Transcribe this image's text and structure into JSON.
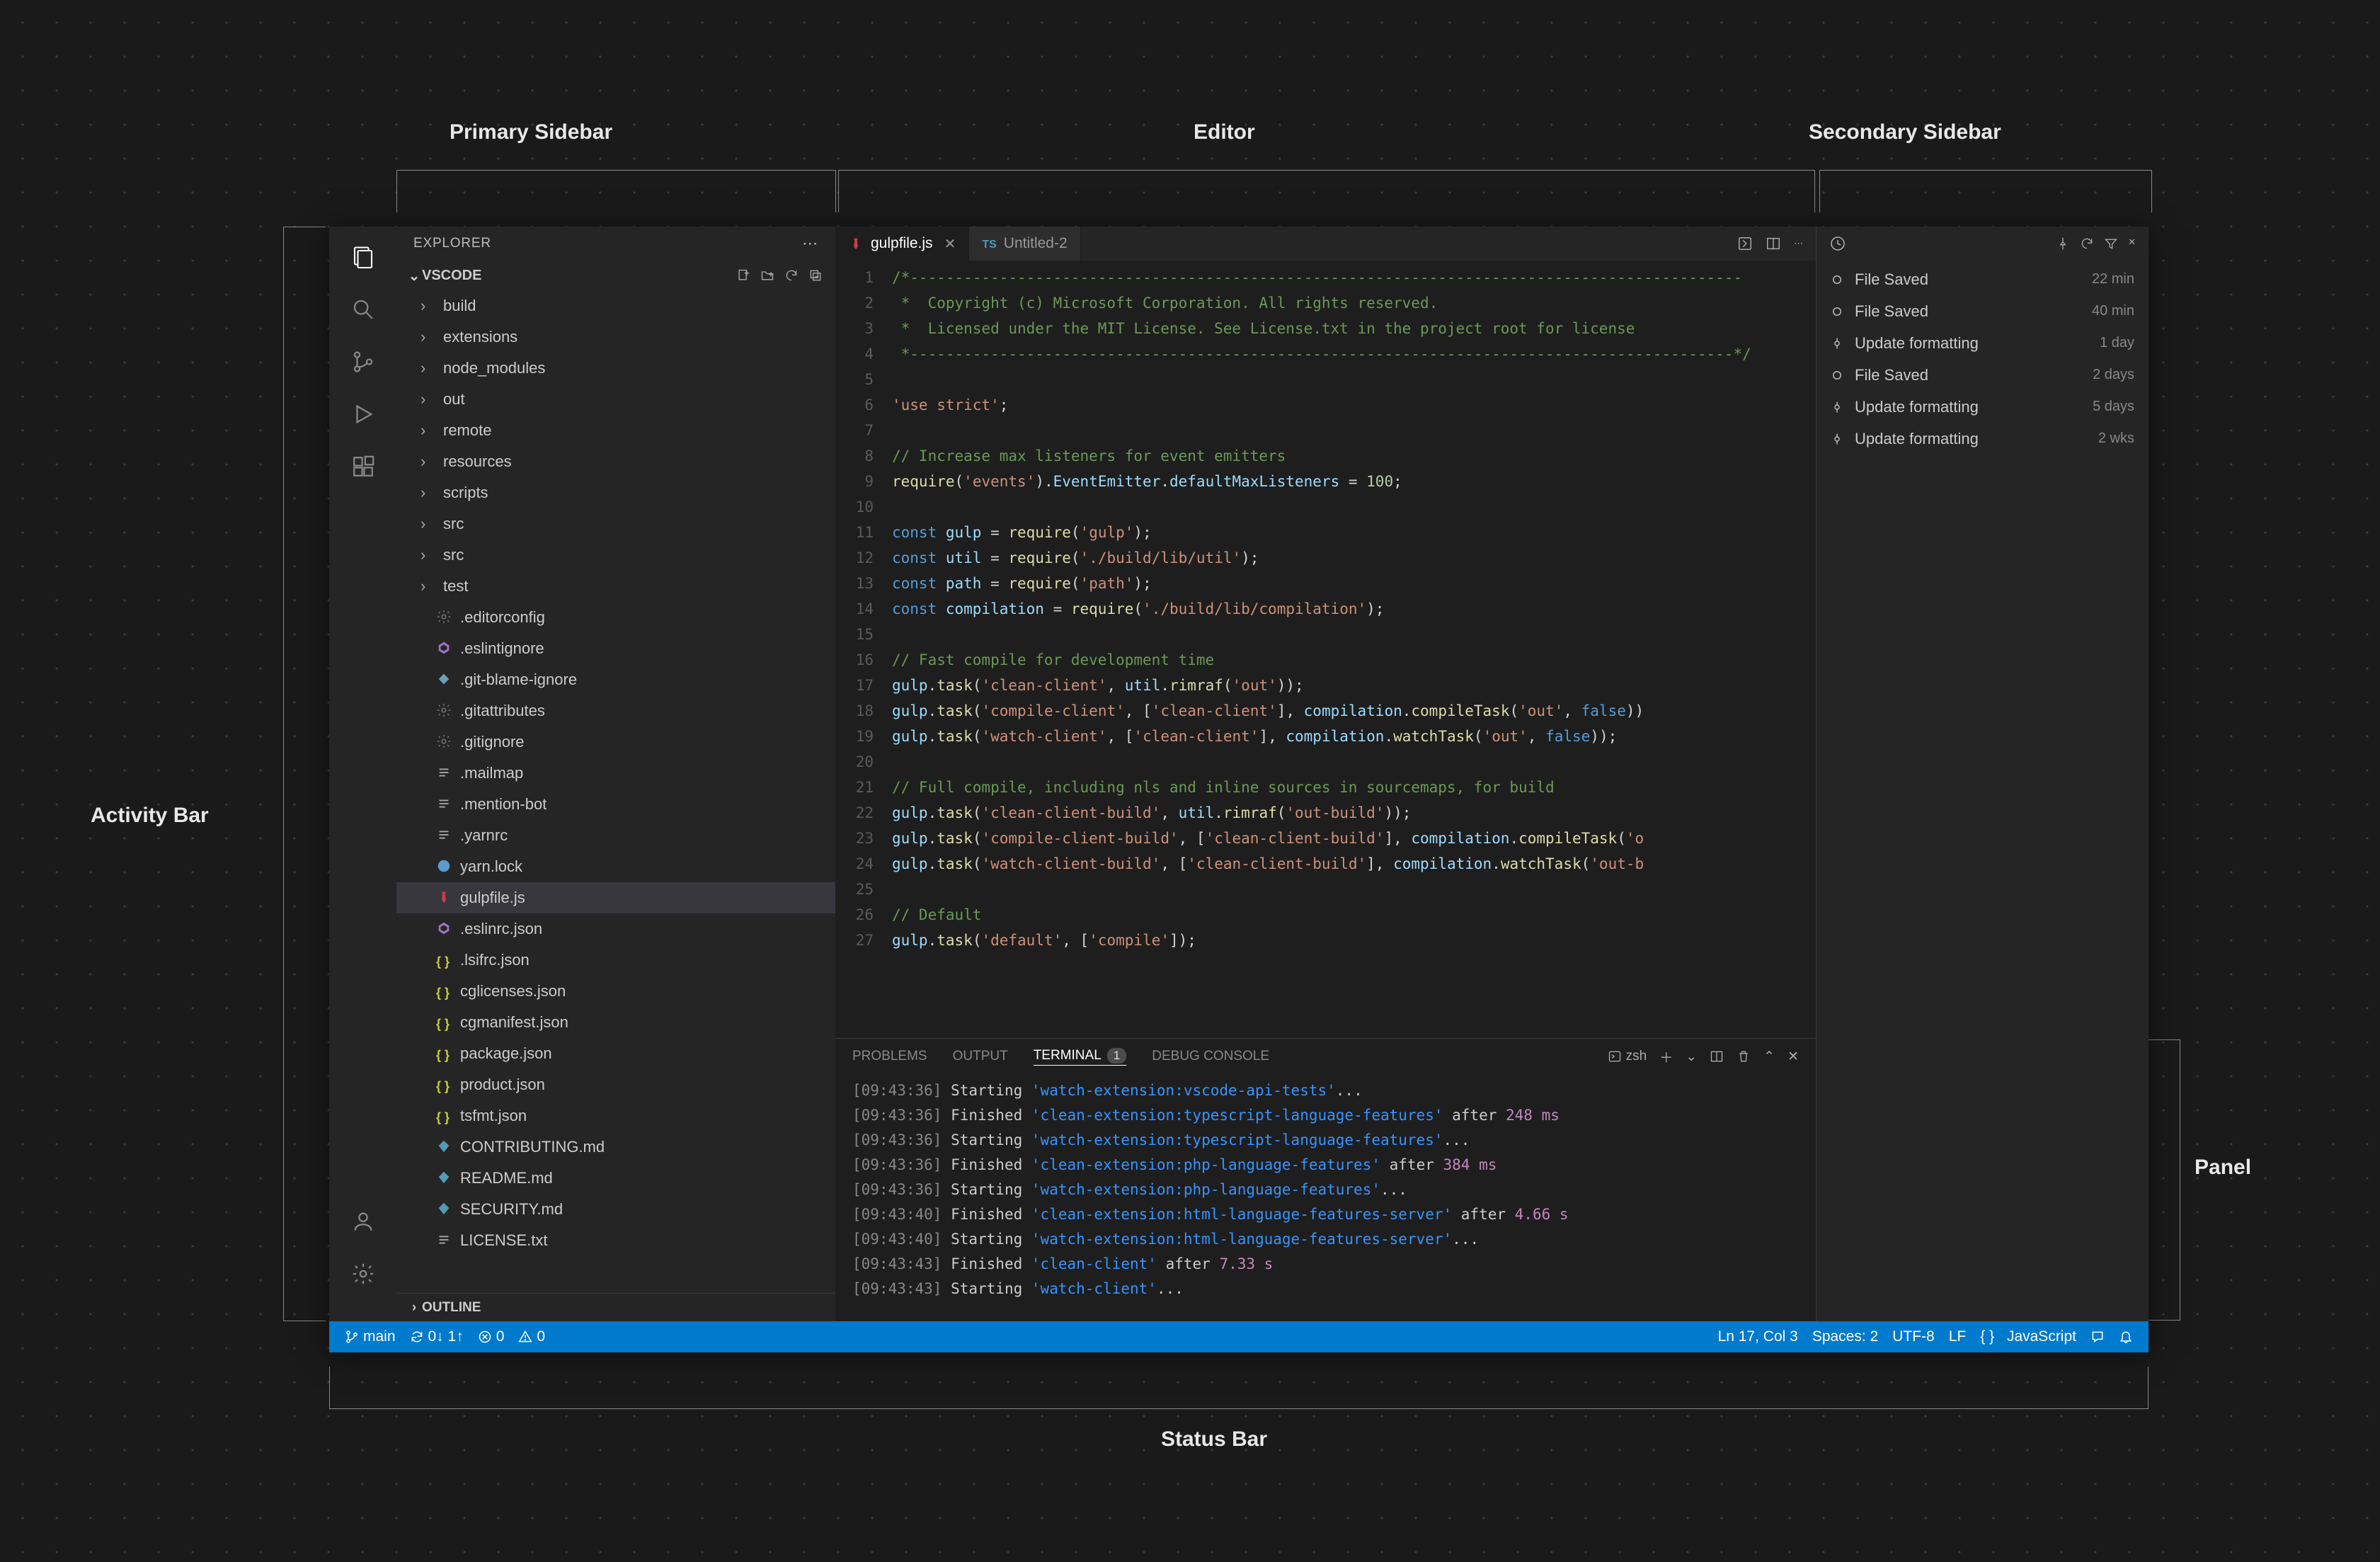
{
  "annotations": {
    "primary_sidebar": "Primary Sidebar",
    "editor": "Editor",
    "secondary_sidebar": "Secondary Sidebar",
    "activity_bar": "Activity Bar",
    "panel": "Panel",
    "status_bar": "Status Bar"
  },
  "sidebar": {
    "title": "EXPLORER",
    "section": "VSCODE",
    "outline": "OUTLINE",
    "folders": [
      "build",
      "extensions",
      "node_modules",
      "out",
      "remote",
      "resources",
      "scripts",
      "src",
      "src",
      "test"
    ],
    "files": [
      {
        "name": ".editorconfig",
        "icon": "gear",
        "color": "#777"
      },
      {
        "name": ".eslintignore",
        "icon": "eslint",
        "color": "#a074c4"
      },
      {
        "name": ".git-blame-ignore",
        "icon": "diamond",
        "color": "#6a9fb5"
      },
      {
        "name": ".gitattributes",
        "icon": "gear",
        "color": "#777"
      },
      {
        "name": ".gitignore",
        "icon": "gear",
        "color": "#777"
      },
      {
        "name": ".mailmap",
        "icon": "lines",
        "color": "#aaa"
      },
      {
        "name": ".mention-bot",
        "icon": "lines",
        "color": "#aaa"
      },
      {
        "name": ".yarnrc",
        "icon": "lines",
        "color": "#aaa"
      },
      {
        "name": "yarn.lock",
        "icon": "yarn",
        "color": "#5a9bcf"
      },
      {
        "name": "gulpfile.js",
        "icon": "gulp",
        "color": "#cc3e44",
        "selected": true
      },
      {
        "name": ".eslinrc.json",
        "icon": "eslint",
        "color": "#a074c4"
      },
      {
        "name": ".lsifrc.json",
        "icon": "braces",
        "color": "#cbcb41"
      },
      {
        "name": "cglicenses.json",
        "icon": "braces",
        "color": "#cbcb41"
      },
      {
        "name": "cgmanifest.json",
        "icon": "braces",
        "color": "#cbcb41"
      },
      {
        "name": "package.json",
        "icon": "braces",
        "color": "#cbcb41"
      },
      {
        "name": "product.json",
        "icon": "braces",
        "color": "#cbcb41"
      },
      {
        "name": "tsfmt.json",
        "icon": "braces",
        "color": "#cbcb41"
      },
      {
        "name": "CONTRIBUTING.md",
        "icon": "md",
        "color": "#519aba"
      },
      {
        "name": "README.md",
        "icon": "md",
        "color": "#519aba"
      },
      {
        "name": "SECURITY.md",
        "icon": "md",
        "color": "#519aba"
      },
      {
        "name": "LICENSE.txt",
        "icon": "lines",
        "color": "#aaa"
      }
    ]
  },
  "tabs": [
    {
      "label": "gulpfile.js",
      "icon": "gulp",
      "color": "#cc3e44",
      "active": true,
      "close": true
    },
    {
      "label": "Untitled-2",
      "icon": "ts",
      "color": "#519aba",
      "prefix": "TS",
      "active": false
    }
  ],
  "code": {
    "lines": [
      {
        "n": 1,
        "tokens": [
          {
            "c": "c-cm",
            "t": "/*---------------------------------------------------------------------------------------------"
          }
        ]
      },
      {
        "n": 2,
        "tokens": [
          {
            "c": "c-cm",
            "t": " *  Copyright (c) Microsoft Corporation. All rights reserved."
          }
        ]
      },
      {
        "n": 3,
        "tokens": [
          {
            "c": "c-cm",
            "t": " *  Licensed under the MIT License. See License.txt in the project root for license"
          }
        ]
      },
      {
        "n": 4,
        "tokens": [
          {
            "c": "c-cm",
            "t": " *--------------------------------------------------------------------------------------------*/"
          }
        ]
      },
      {
        "n": 5,
        "tokens": []
      },
      {
        "n": 6,
        "tokens": [
          {
            "c": "c-str",
            "t": "'use strict'"
          },
          {
            "c": "c-pl",
            "t": ";"
          }
        ]
      },
      {
        "n": 7,
        "tokens": []
      },
      {
        "n": 8,
        "tokens": [
          {
            "c": "c-cm",
            "t": "// Increase max listeners for event emitters"
          }
        ]
      },
      {
        "n": 9,
        "tokens": [
          {
            "c": "c-fn",
            "t": "require"
          },
          {
            "c": "c-pl",
            "t": "("
          },
          {
            "c": "c-str",
            "t": "'events'"
          },
          {
            "c": "c-pl",
            "t": ")."
          },
          {
            "c": "c-v",
            "t": "EventEmitter"
          },
          {
            "c": "c-pl",
            "t": "."
          },
          {
            "c": "c-v",
            "t": "defaultMaxListeners"
          },
          {
            "c": "c-pl",
            "t": " = "
          },
          {
            "c": "c-num",
            "t": "100"
          },
          {
            "c": "c-pl",
            "t": ";"
          }
        ]
      },
      {
        "n": 10,
        "tokens": []
      },
      {
        "n": 11,
        "tokens": [
          {
            "c": "c-kw",
            "t": "const "
          },
          {
            "c": "c-v",
            "t": "gulp"
          },
          {
            "c": "c-pl",
            "t": " = "
          },
          {
            "c": "c-fn",
            "t": "require"
          },
          {
            "c": "c-pl",
            "t": "("
          },
          {
            "c": "c-str",
            "t": "'gulp'"
          },
          {
            "c": "c-pl",
            "t": ");"
          }
        ]
      },
      {
        "n": 12,
        "tokens": [
          {
            "c": "c-kw",
            "t": "const "
          },
          {
            "c": "c-v",
            "t": "util"
          },
          {
            "c": "c-pl",
            "t": " = "
          },
          {
            "c": "c-fn",
            "t": "require"
          },
          {
            "c": "c-pl",
            "t": "("
          },
          {
            "c": "c-str",
            "t": "'./build/lib/util'"
          },
          {
            "c": "c-pl",
            "t": ");"
          }
        ]
      },
      {
        "n": 13,
        "tokens": [
          {
            "c": "c-kw",
            "t": "const "
          },
          {
            "c": "c-v",
            "t": "path"
          },
          {
            "c": "c-pl",
            "t": " = "
          },
          {
            "c": "c-fn",
            "t": "require"
          },
          {
            "c": "c-pl",
            "t": "("
          },
          {
            "c": "c-str",
            "t": "'path'"
          },
          {
            "c": "c-pl",
            "t": ");"
          }
        ]
      },
      {
        "n": 14,
        "tokens": [
          {
            "c": "c-kw",
            "t": "const "
          },
          {
            "c": "c-v",
            "t": "compilation"
          },
          {
            "c": "c-pl",
            "t": " = "
          },
          {
            "c": "c-fn",
            "t": "require"
          },
          {
            "c": "c-pl",
            "t": "("
          },
          {
            "c": "c-str",
            "t": "'./build/lib/compilation'"
          },
          {
            "c": "c-pl",
            "t": ");"
          }
        ]
      },
      {
        "n": 15,
        "tokens": []
      },
      {
        "n": 16,
        "tokens": [
          {
            "c": "c-cm",
            "t": "// Fast compile for development time"
          }
        ]
      },
      {
        "n": 17,
        "tokens": [
          {
            "c": "c-v",
            "t": "gulp"
          },
          {
            "c": "c-pl",
            "t": "."
          },
          {
            "c": "c-fn",
            "t": "task"
          },
          {
            "c": "c-pl",
            "t": "("
          },
          {
            "c": "c-str",
            "t": "'clean-client'"
          },
          {
            "c": "c-pl",
            "t": ", "
          },
          {
            "c": "c-v",
            "t": "util"
          },
          {
            "c": "c-pl",
            "t": "."
          },
          {
            "c": "c-fn",
            "t": "rimraf"
          },
          {
            "c": "c-pl",
            "t": "("
          },
          {
            "c": "c-str",
            "t": "'out'"
          },
          {
            "c": "c-pl",
            "t": "));"
          }
        ]
      },
      {
        "n": 18,
        "tokens": [
          {
            "c": "c-v",
            "t": "gulp"
          },
          {
            "c": "c-pl",
            "t": "."
          },
          {
            "c": "c-fn",
            "t": "task"
          },
          {
            "c": "c-pl",
            "t": "("
          },
          {
            "c": "c-str",
            "t": "'compile-client'"
          },
          {
            "c": "c-pl",
            "t": ", ["
          },
          {
            "c": "c-str",
            "t": "'clean-client'"
          },
          {
            "c": "c-pl",
            "t": "], "
          },
          {
            "c": "c-v",
            "t": "compilation"
          },
          {
            "c": "c-pl",
            "t": "."
          },
          {
            "c": "c-fn",
            "t": "compileTask"
          },
          {
            "c": "c-pl",
            "t": "("
          },
          {
            "c": "c-str",
            "t": "'out'"
          },
          {
            "c": "c-pl",
            "t": ", "
          },
          {
            "c": "c-kw",
            "t": "false"
          },
          {
            "c": "c-pl",
            "t": "))"
          }
        ]
      },
      {
        "n": 19,
        "tokens": [
          {
            "c": "c-v",
            "t": "gulp"
          },
          {
            "c": "c-pl",
            "t": "."
          },
          {
            "c": "c-fn",
            "t": "task"
          },
          {
            "c": "c-pl",
            "t": "("
          },
          {
            "c": "c-str",
            "t": "'watch-client'"
          },
          {
            "c": "c-pl",
            "t": ", ["
          },
          {
            "c": "c-str",
            "t": "'clean-client'"
          },
          {
            "c": "c-pl",
            "t": "], "
          },
          {
            "c": "c-v",
            "t": "compilation"
          },
          {
            "c": "c-pl",
            "t": "."
          },
          {
            "c": "c-fn",
            "t": "watchTask"
          },
          {
            "c": "c-pl",
            "t": "("
          },
          {
            "c": "c-str",
            "t": "'out'"
          },
          {
            "c": "c-pl",
            "t": ", "
          },
          {
            "c": "c-kw",
            "t": "false"
          },
          {
            "c": "c-pl",
            "t": "));"
          }
        ]
      },
      {
        "n": 20,
        "tokens": []
      },
      {
        "n": 21,
        "tokens": [
          {
            "c": "c-cm",
            "t": "// Full compile, including nls and inline sources in sourcemaps, for build"
          }
        ]
      },
      {
        "n": 22,
        "tokens": [
          {
            "c": "c-v",
            "t": "gulp"
          },
          {
            "c": "c-pl",
            "t": "."
          },
          {
            "c": "c-fn",
            "t": "task"
          },
          {
            "c": "c-pl",
            "t": "("
          },
          {
            "c": "c-str",
            "t": "'clean-client-build'"
          },
          {
            "c": "c-pl",
            "t": ", "
          },
          {
            "c": "c-v",
            "t": "util"
          },
          {
            "c": "c-pl",
            "t": "."
          },
          {
            "c": "c-fn",
            "t": "rimraf"
          },
          {
            "c": "c-pl",
            "t": "("
          },
          {
            "c": "c-str",
            "t": "'out-build'"
          },
          {
            "c": "c-pl",
            "t": "));"
          }
        ]
      },
      {
        "n": 23,
        "tokens": [
          {
            "c": "c-v",
            "t": "gulp"
          },
          {
            "c": "c-pl",
            "t": "."
          },
          {
            "c": "c-fn",
            "t": "task"
          },
          {
            "c": "c-pl",
            "t": "("
          },
          {
            "c": "c-str",
            "t": "'compile-client-build'"
          },
          {
            "c": "c-pl",
            "t": ", ["
          },
          {
            "c": "c-str",
            "t": "'clean-client-build'"
          },
          {
            "c": "c-pl",
            "t": "], "
          },
          {
            "c": "c-v",
            "t": "compilation"
          },
          {
            "c": "c-pl",
            "t": "."
          },
          {
            "c": "c-fn",
            "t": "compileTask"
          },
          {
            "c": "c-pl",
            "t": "("
          },
          {
            "c": "c-str",
            "t": "'o"
          }
        ]
      },
      {
        "n": 24,
        "tokens": [
          {
            "c": "c-v",
            "t": "gulp"
          },
          {
            "c": "c-pl",
            "t": "."
          },
          {
            "c": "c-fn",
            "t": "task"
          },
          {
            "c": "c-pl",
            "t": "("
          },
          {
            "c": "c-str",
            "t": "'watch-client-build'"
          },
          {
            "c": "c-pl",
            "t": ", ["
          },
          {
            "c": "c-str",
            "t": "'clean-client-build'"
          },
          {
            "c": "c-pl",
            "t": "], "
          },
          {
            "c": "c-v",
            "t": "compilation"
          },
          {
            "c": "c-pl",
            "t": "."
          },
          {
            "c": "c-fn",
            "t": "watchTask"
          },
          {
            "c": "c-pl",
            "t": "("
          },
          {
            "c": "c-str",
            "t": "'out-b"
          }
        ]
      },
      {
        "n": 25,
        "tokens": []
      },
      {
        "n": 26,
        "tokens": [
          {
            "c": "c-cm",
            "t": "// Default"
          }
        ]
      },
      {
        "n": 27,
        "tokens": [
          {
            "c": "c-v",
            "t": "gulp"
          },
          {
            "c": "c-pl",
            "t": "."
          },
          {
            "c": "c-fn",
            "t": "task"
          },
          {
            "c": "c-pl",
            "t": "("
          },
          {
            "c": "c-str",
            "t": "'default'"
          },
          {
            "c": "c-pl",
            "t": ", ["
          },
          {
            "c": "c-str",
            "t": "'compile'"
          },
          {
            "c": "c-pl",
            "t": "]);"
          }
        ]
      }
    ]
  },
  "panel": {
    "tabs": {
      "problems": "PROBLEMS",
      "output": "OUTPUT",
      "terminal": "TERMINAL",
      "debug": "DEBUG CONSOLE",
      "terminal_badge": "1"
    },
    "shell": "zsh",
    "lines": [
      {
        "ts": "[09:43:36]",
        "act": "Starting",
        "name": "'watch-extension:vscode-api-tests'",
        "tail": "..."
      },
      {
        "ts": "[09:43:36]",
        "act": "Finished",
        "name": "'clean-extension:typescript-language-features'",
        "tail": " after ",
        "dur": "248 ms"
      },
      {
        "ts": "[09:43:36]",
        "act": "Starting",
        "name": "'watch-extension:typescript-language-features'",
        "tail": "..."
      },
      {
        "ts": "[09:43:36]",
        "act": "Finished",
        "name": "'clean-extension:php-language-features'",
        "tail": " after ",
        "dur": "384 ms"
      },
      {
        "ts": "[09:43:36]",
        "act": "Starting",
        "name": "'watch-extension:php-language-features'",
        "tail": "..."
      },
      {
        "ts": "[09:43:40]",
        "act": "Finished",
        "name": "'clean-extension:html-language-features-server'",
        "tail": " after ",
        "dur": "4.66 s"
      },
      {
        "ts": "[09:43:40]",
        "act": "Starting",
        "name": "'watch-extension:html-language-features-server'",
        "tail": "..."
      },
      {
        "ts": "[09:43:43]",
        "act": "Finished",
        "name": "'clean-client'",
        "tail": " after ",
        "dur": "7.33 s"
      },
      {
        "ts": "[09:43:43]",
        "act": "Starting",
        "name": "'watch-client'",
        "tail": "..."
      }
    ]
  },
  "timeline": [
    {
      "icon": "circle",
      "label": "File Saved",
      "time": "22 min"
    },
    {
      "icon": "circle",
      "label": "File Saved",
      "time": "40 min"
    },
    {
      "icon": "commit",
      "label": "Update formatting",
      "time": "1 day"
    },
    {
      "icon": "circle",
      "label": "File Saved",
      "time": "2 days"
    },
    {
      "icon": "commit",
      "label": "Update formatting",
      "time": "5 days"
    },
    {
      "icon": "commit",
      "label": "Update formatting",
      "time": "2 wks"
    }
  ],
  "status": {
    "branch": "main",
    "sync": "0↓ 1↑",
    "errors": "0",
    "warnings": "0",
    "cursor": "Ln 17, Col 3",
    "spaces": "Spaces: 2",
    "encoding": "UTF-8",
    "eol": "LF",
    "lang": "JavaScript",
    "lang_icon": "{ }"
  }
}
